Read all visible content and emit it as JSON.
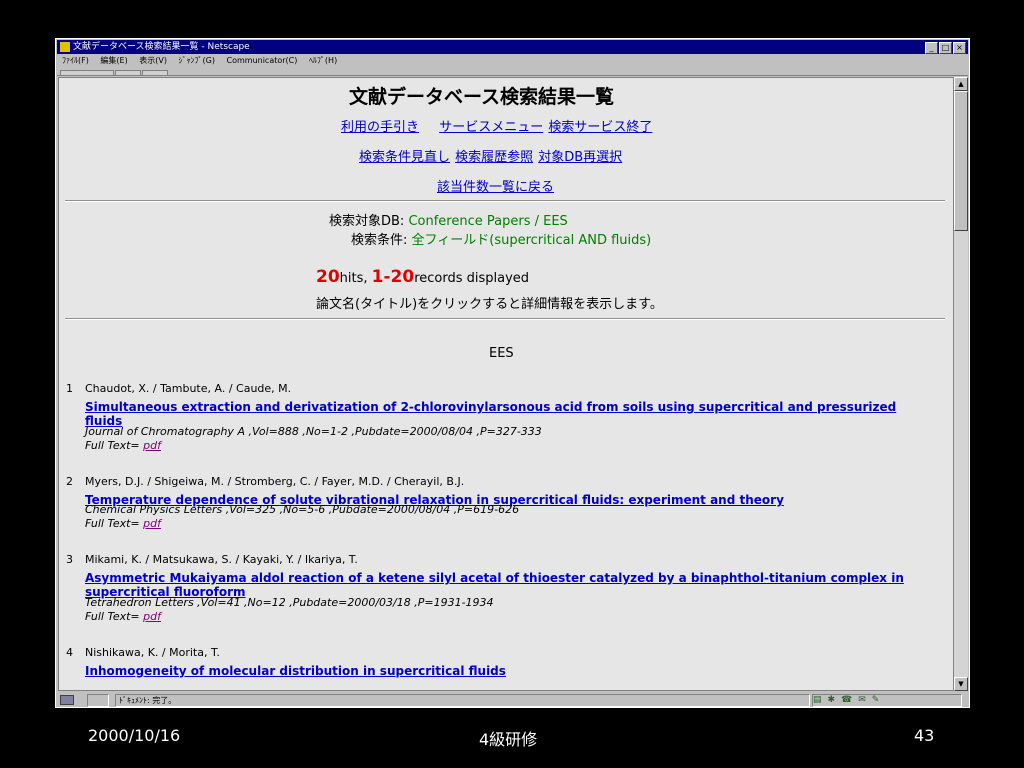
{
  "window": {
    "title": "文献データベース検索結果一覧 - Netscape",
    "buttons": [
      "_",
      "□",
      "×"
    ]
  },
  "menu": [
    "ﾌｧｲﾙ(F)",
    "編集(E)",
    "表示(V)",
    "ｼﾞｬﾝﾌﾟ(G)",
    "Communicator(C)",
    "ﾍﾙﾌﾟ(H)"
  ],
  "page": {
    "heading": "文献データベース検索結果一覧",
    "nav1": [
      "利用の手引き",
      "サービスメニュー",
      "検索サービス終了"
    ],
    "nav2": [
      "検索条件見直し",
      "検索履歴参照",
      "対象DB再選択"
    ],
    "nav3": "該当件数一覧に戻る",
    "db_label": "検索対象DB:",
    "db_value": "Conference Papers / EES",
    "cond_label": "検索条件:",
    "cond_value": "全フィールド(supercritical AND fluids)",
    "hits_num": "20",
    "hits_text": "hits,",
    "range_num": "1-20",
    "range_text": "records displayed",
    "instruction": "論文名(タイトル)をクリックすると詳細情報を表示します。",
    "section": "EES",
    "fulltext_label": "Full Text=",
    "fulltext_link": "pdf",
    "results": [
      {
        "num": "1",
        "authors": "Chaudot, X. / Tambute, A. / Caude, M.",
        "title_l1": "Simultaneous extraction and derivatization of 2-chlorovinylarsonous acid from soils using supercritical and pressurized",
        "title_l2": "fluids",
        "journal": "Journal of Chromatography A ,Vol=888 ,No=1-2 ,Pubdate=2000/08/04 ,P=327-333"
      },
      {
        "num": "2",
        "authors": "Myers, D.J. / Shigeiwa, M. / Stromberg, C. / Fayer, M.D. / Cherayil, B.J.",
        "title_l1": "Temperature dependence of solute vibrational relaxation in supercritical fluids: experiment and theory",
        "title_l2": "",
        "journal": "Chemical Physics Letters ,Vol=325 ,No=5-6 ,Pubdate=2000/08/04 ,P=619-626"
      },
      {
        "num": "3",
        "authors": "Mikami, K. / Matsukawa, S. / Kayaki, Y. / Ikariya, T.",
        "title_l1": "Asymmetric Mukaiyama aldol reaction of a ketene silyl acetal of thioester catalyzed by a binaphthol-titanium complex in",
        "title_l2": "supercritical fluoroform",
        "journal": "Tetrahedron Letters ,Vol=41 ,No=12 ,Pubdate=2000/03/18 ,P=1931-1934"
      },
      {
        "num": "4",
        "authors": "Nishikawa, K. / Morita, T.",
        "title_l1": "Inhomogeneity of molecular distribution in supercritical fluids",
        "title_l2": "",
        "journal": ""
      }
    ]
  },
  "status": {
    "text": "ﾄﾞｷｭﾒﾝﾄ: 完了。"
  },
  "footer": {
    "date": "2000/10/16",
    "center": "4級研修",
    "page": "43"
  }
}
